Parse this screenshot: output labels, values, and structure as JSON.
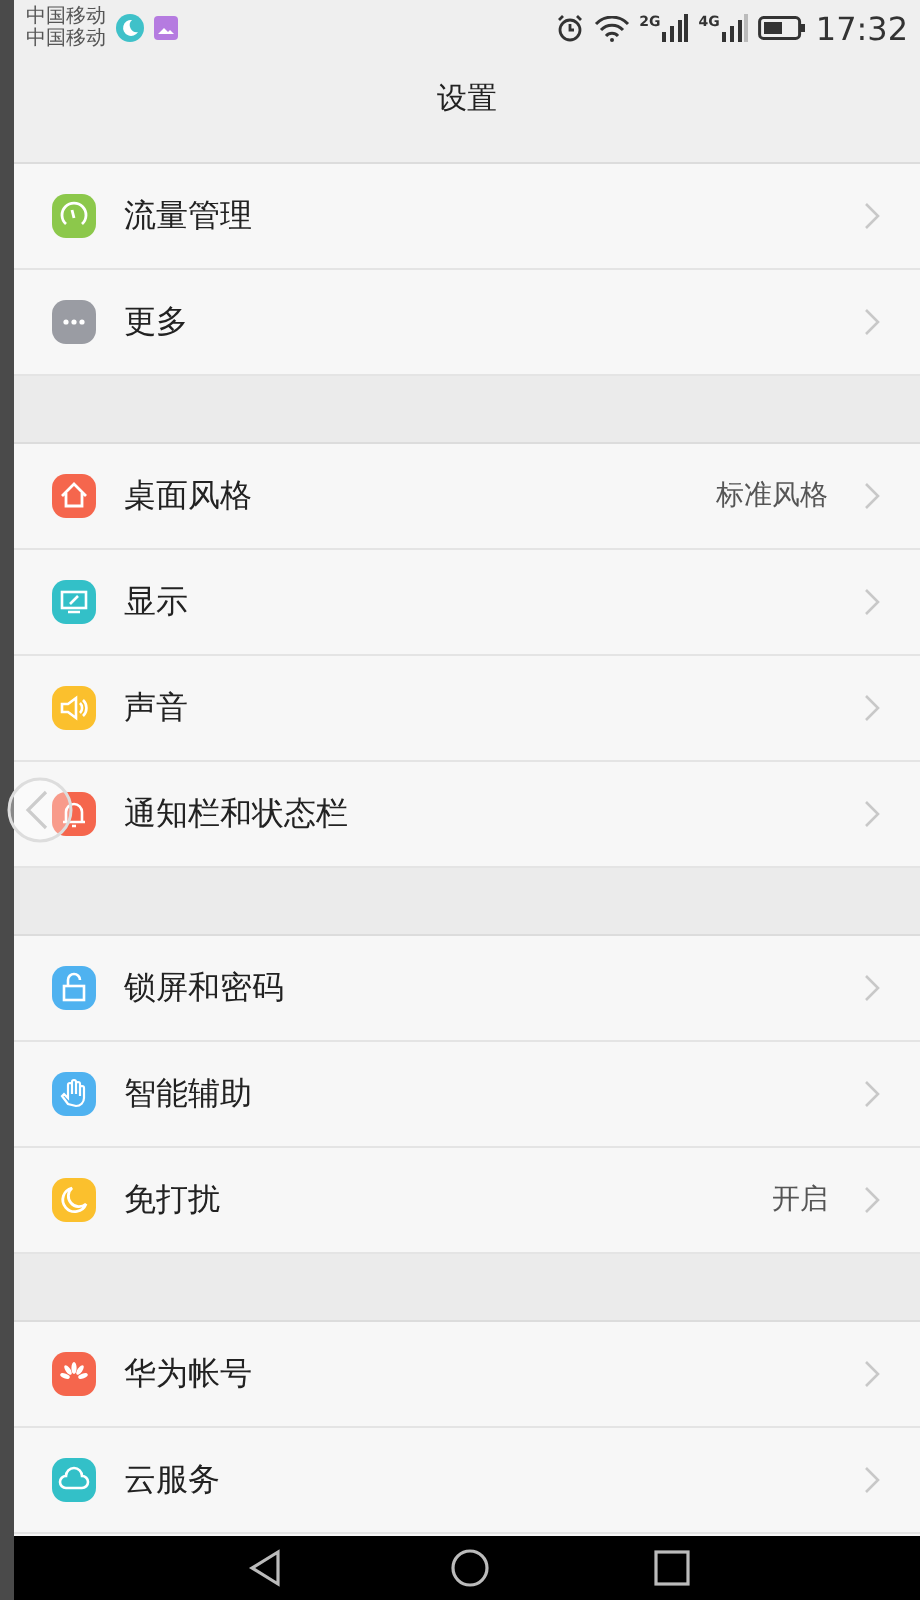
{
  "status_bar": {
    "carriers": [
      "中国移动",
      "中国移动"
    ],
    "network_labels": [
      "2G",
      "4G"
    ],
    "time": "17:32"
  },
  "header": {
    "title": "设置"
  },
  "groups": [
    {
      "items": [
        {
          "label": "流量管理"
        },
        {
          "label": "更多"
        }
      ]
    },
    {
      "items": [
        {
          "label": "桌面风格",
          "value": "标准风格"
        },
        {
          "label": "显示"
        },
        {
          "label": "声音"
        },
        {
          "label": "通知栏和状态栏"
        }
      ]
    },
    {
      "items": [
        {
          "label": "锁屏和密码"
        },
        {
          "label": "智能辅助"
        },
        {
          "label": "免打扰",
          "value": "开启"
        }
      ]
    },
    {
      "items": [
        {
          "label": "华为帐号"
        },
        {
          "label": "云服务"
        }
      ]
    }
  ]
}
